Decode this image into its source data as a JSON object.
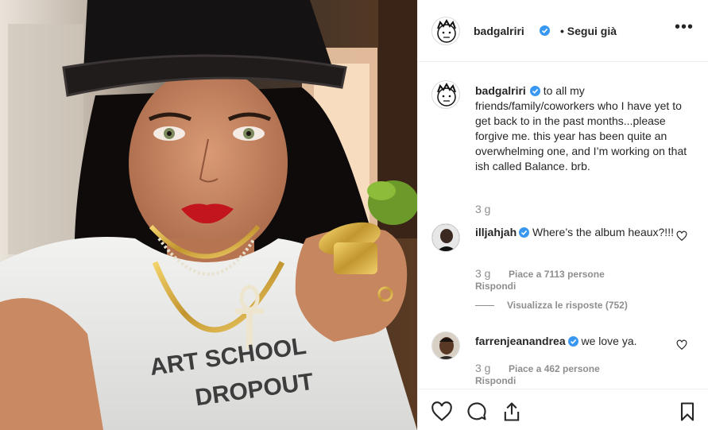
{
  "post": {
    "image_text": [
      "ART SCHOOL",
      "DROPOUT"
    ]
  },
  "header": {
    "username": "badgalriri",
    "follow_status": "• Segui già",
    "more_label": "•••"
  },
  "caption": {
    "username": "badgalriri",
    "text": "to all my friends/family/coworkers who I have yet to get back to in the past months...please forgive me. this year has been quite an overwhelming one, and I’m working on that ish called Balance. brb.",
    "time": "3 g"
  },
  "comments": [
    {
      "username": "illjahjah",
      "text": "Where’s the album heaux?!!!",
      "time": "3 g",
      "likes": "Piace a 7113 persone",
      "reply": "Rispondi",
      "view_replies": "Visualizza le risposte (752)"
    },
    {
      "username": "farrenjeanandrea",
      "text": "we love ya.",
      "time": "3 g",
      "likes": "Piace a 462 persone",
      "reply": "Rispondi"
    }
  ],
  "icons": {
    "like": "heart-icon",
    "comment": "comment-icon",
    "share": "share-icon",
    "save": "bookmark-icon",
    "verified": "verified-badge-icon"
  },
  "colors": {
    "verified": "#3897f0",
    "secondary_text": "#8e8e8e",
    "primary_text": "#262626"
  }
}
